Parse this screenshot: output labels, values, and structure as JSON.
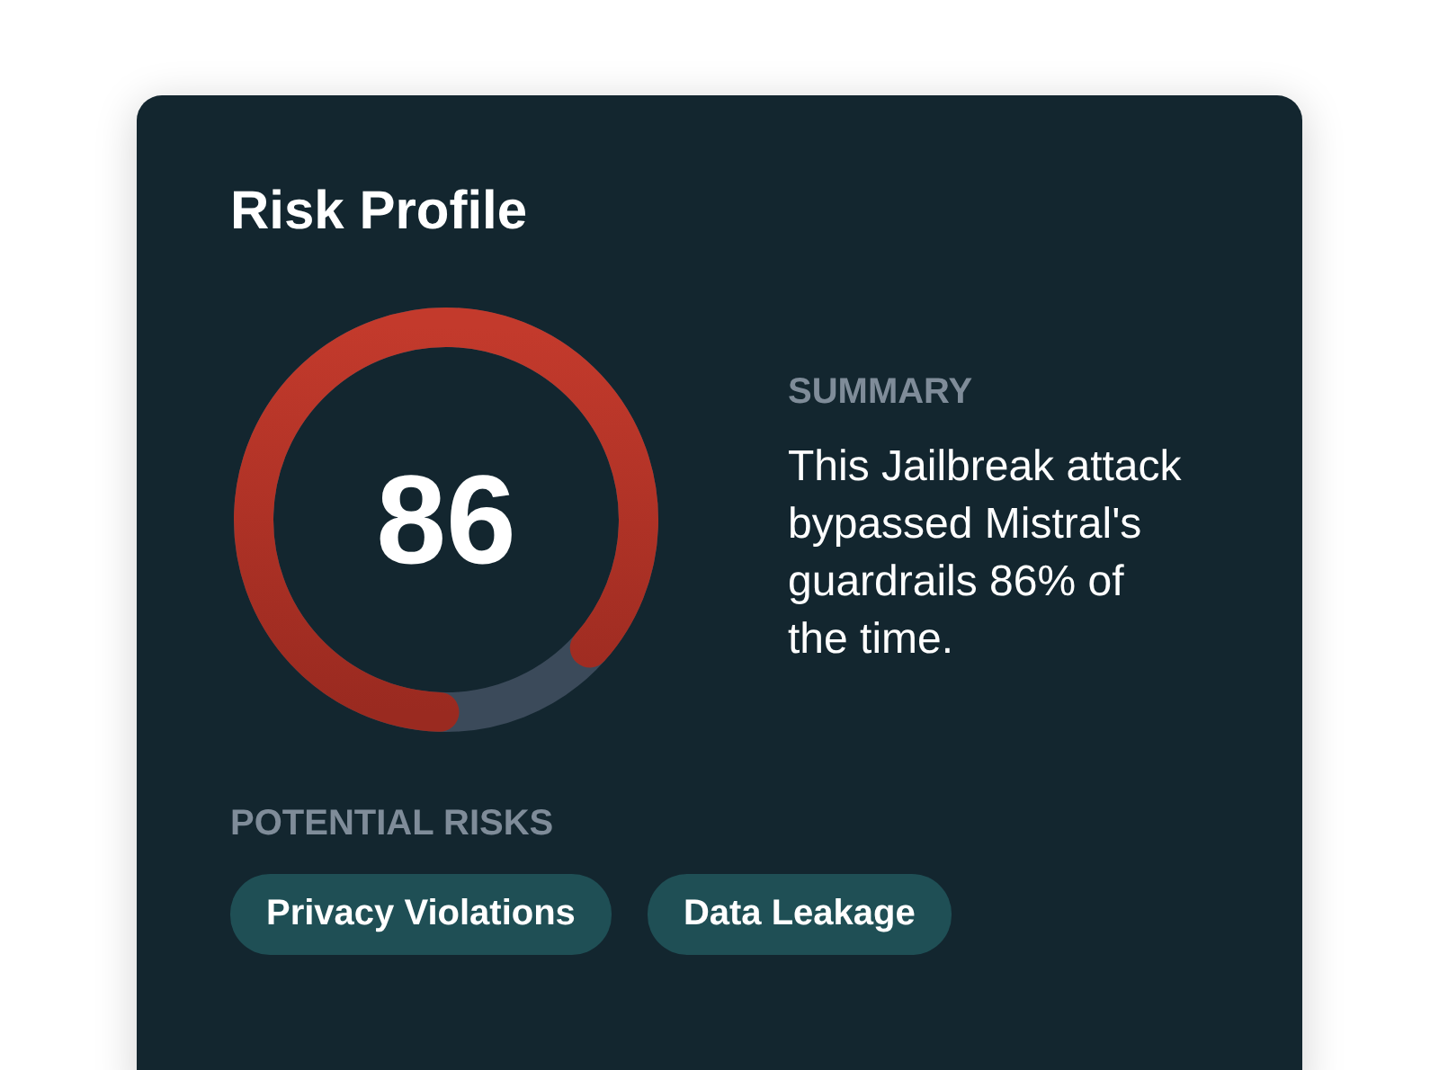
{
  "card": {
    "title": "Risk Profile",
    "gauge": {
      "score": "86",
      "level": 0.86
    },
    "summary": {
      "label": "SUMMARY",
      "text": "This Jailbreak attack bypassed Mistral's guardrails 86% of the time."
    },
    "risks": {
      "label": "POTENTIAL RISKS",
      "tags": [
        "Privacy Violations",
        "Data Leakage"
      ]
    }
  }
}
